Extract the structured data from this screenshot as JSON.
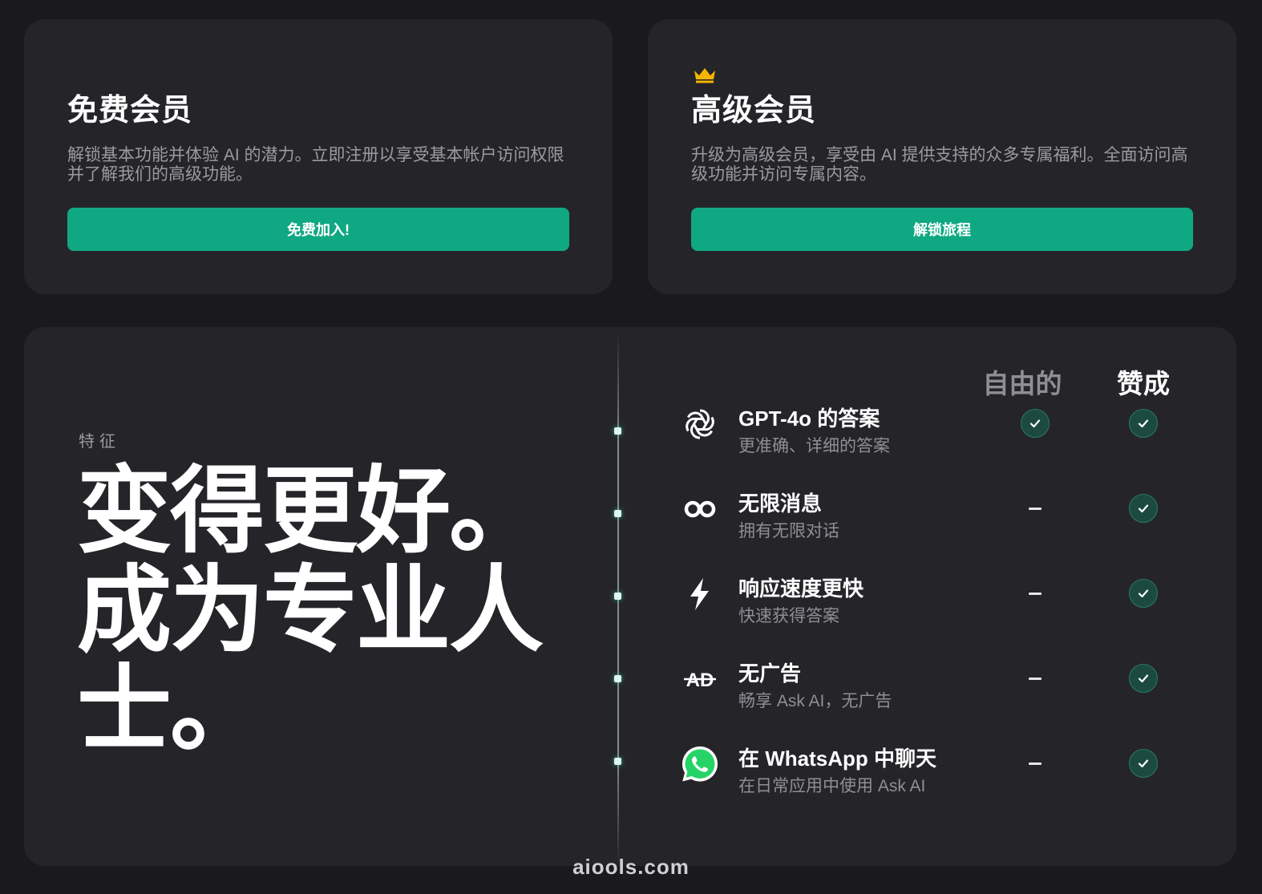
{
  "plans": {
    "free": {
      "title": "免费会员",
      "description": "解锁基本功能并体验 AI 的潜力。立即注册以享受基本帐户访问权限并了解我们的高级功能。",
      "button_label": "免费加入!"
    },
    "premium": {
      "icon": "crown-icon",
      "title": "高级会员",
      "description": "升级为高级会员，享受由 AI 提供支持的众多专属福利。全面访问高级功能并访问专属内容。",
      "button_label": "解锁旅程"
    }
  },
  "features": {
    "eyebrow": "特征",
    "headline_line1": "变得更好。",
    "headline_line2": "成为专业人士。",
    "columns": {
      "free": "自由的",
      "pro": "赞成"
    },
    "rows": [
      {
        "icon": "openai-icon",
        "title": "GPT-4o 的答案",
        "subtitle": "更准确、详细的答案",
        "free": "check",
        "pro": "check"
      },
      {
        "icon": "infinity-icon",
        "title": "无限消息",
        "subtitle": "拥有无限对话",
        "free": "dash",
        "pro": "check"
      },
      {
        "icon": "lightning-icon",
        "title": "响应速度更快",
        "subtitle": "快速获得答案",
        "free": "dash",
        "pro": "check"
      },
      {
        "icon": "no-ads-icon",
        "title": "无广告",
        "subtitle": "畅享 Ask AI，无广告",
        "free": "dash",
        "pro": "check"
      },
      {
        "icon": "whatsapp-icon",
        "title": "在 WhatsApp 中聊天",
        "subtitle": "在日常应用中使用 Ask AI",
        "free": "dash",
        "pro": "check"
      }
    ],
    "no_ads_icon_text": "AD"
  },
  "colors": {
    "background": "#1a1a1e",
    "card": "#252529",
    "accent": "#10a883",
    "crown": "#f5b400",
    "whatsapp": "#25d366"
  },
  "watermark": "aiools.com"
}
